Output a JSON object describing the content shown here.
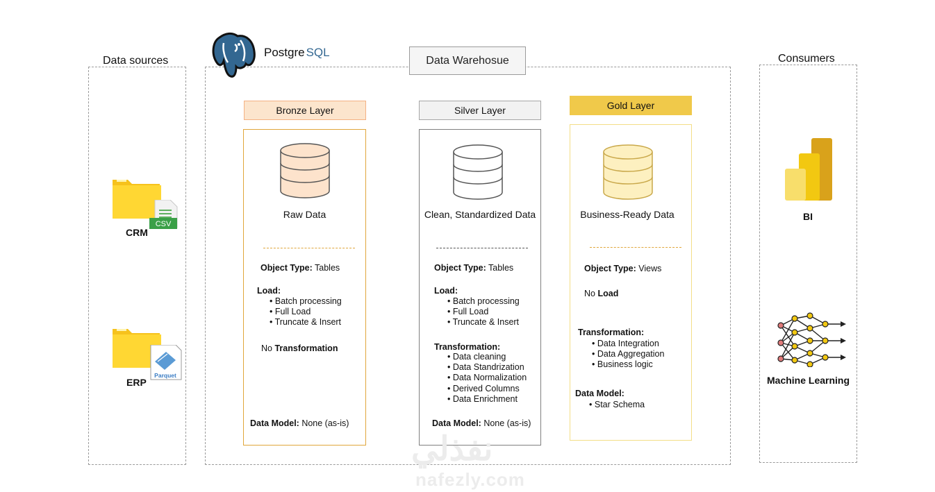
{
  "sections": {
    "sources_title": "Data sources",
    "consumers_title": "Consumers",
    "warehouse_title": "Data Warehosue"
  },
  "postgres": {
    "name_part1": "Postgre",
    "name_part2": "SQL"
  },
  "sources": [
    {
      "label": "CRM",
      "badge": "CSV"
    },
    {
      "label": "ERP",
      "badge": "Parquet"
    }
  ],
  "consumers": [
    {
      "label": "BI"
    },
    {
      "label": "Machine Learning"
    }
  ],
  "layers": {
    "bronze": {
      "title": "Bronze Layer",
      "caption": "Raw Data",
      "object_type_label": "Object Type:",
      "object_type_value": "Tables",
      "load_label": "Load:",
      "load_items": [
        "Batch processing",
        "Full Load",
        "Truncate & Insert"
      ],
      "transformation_prefix": "No",
      "transformation_label": "Transformation",
      "data_model_label": "Data Model:",
      "data_model_value": "None (as-is)",
      "colors": {
        "head_bg": "#fce5cd",
        "head_border": "#f4b183",
        "box_border": "#e0a63a",
        "db_fill": "#fde3cc",
        "db_stroke": "#555555"
      }
    },
    "silver": {
      "title": "Silver Layer",
      "caption": "Clean, Standardized Data",
      "object_type_label": "Object Type:",
      "object_type_value": "Tables",
      "load_label": "Load:",
      "load_items": [
        "Batch processing",
        "Full Load",
        "Truncate & Insert"
      ],
      "transformation_label": "Transformation:",
      "transformation_items": [
        "Data cleaning",
        "Data Standrization",
        "Data Normalization",
        "Derived Columns",
        "Data Enrichment"
      ],
      "data_model_label": "Data Model:",
      "data_model_value": "None (as-is)",
      "colors": {
        "head_bg": "#f2f2f2",
        "head_border": "#a6a6a6",
        "box_border": "#7f7f7f",
        "db_fill": "#ffffff",
        "db_stroke": "#555555"
      }
    },
    "gold": {
      "title": "Gold Layer",
      "caption": "Business-Ready Data",
      "object_type_label": "Object Type:",
      "object_type_value": "Views",
      "load_prefix": "No",
      "load_label": "Load",
      "transformation_label": "Transformation:",
      "transformation_items": [
        "Data Integration",
        "Data Aggregation",
        "Business logic"
      ],
      "data_model_label": "Data Model:",
      "data_model_items": [
        "Star Schema"
      ],
      "colors": {
        "head_bg": "#f0c94a",
        "head_border": "#f0c94a",
        "box_border": "#f3de86",
        "db_fill": "#fdf0c0",
        "db_stroke": "#c9a84a"
      }
    }
  },
  "watermark": {
    "arabic": "نفذلي",
    "latin": "nafezly.com"
  }
}
